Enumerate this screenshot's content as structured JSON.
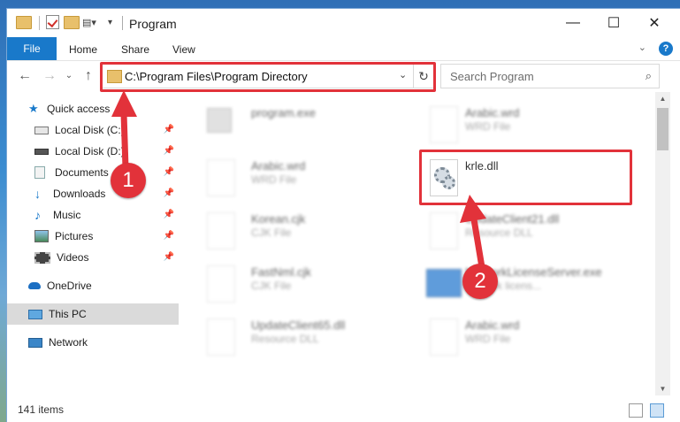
{
  "window": {
    "title": "Program",
    "minimize": "—",
    "maximize": "☐",
    "close": "✕"
  },
  "ribbon": {
    "tabs": [
      "File",
      "Home",
      "Share",
      "View"
    ],
    "help": "?",
    "collapse": "⌄"
  },
  "nav": {
    "back": "←",
    "forward": "→",
    "recent": "⌄",
    "up": "↑",
    "address": "C:\\Program Files\\Program Directory",
    "address_dropdown": "⌄",
    "refresh": "↻",
    "search_placeholder": "Search Program",
    "search_icon": "⌕"
  },
  "sidebar": {
    "items": [
      {
        "label": "Quick access",
        "icon": "star-icon",
        "pinned": false
      },
      {
        "label": "Local Disk (C:)",
        "icon": "drive-icon",
        "pinned": true
      },
      {
        "label": "Local Disk (D:)",
        "icon": "drive-icon",
        "pinned": true
      },
      {
        "label": "Documents",
        "icon": "documents-icon",
        "pinned": true
      },
      {
        "label": "Downloads",
        "icon": "download-icon",
        "pinned": true
      },
      {
        "label": "Music",
        "icon": "music-icon",
        "pinned": true
      },
      {
        "label": "Pictures",
        "icon": "pictures-icon",
        "pinned": true
      },
      {
        "label": "Videos",
        "icon": "videos-icon",
        "pinned": true
      },
      {
        "label": "OneDrive",
        "icon": "cloud-icon",
        "pinned": false
      },
      {
        "label": "This PC",
        "icon": "computer-icon",
        "pinned": false,
        "selected": true
      },
      {
        "label": "Network",
        "icon": "network-icon",
        "pinned": false
      }
    ],
    "pin_glyph": "✎"
  },
  "files": {
    "left": [
      {
        "name": "program.exe",
        "type": ""
      },
      {
        "name": "Arabic.wrd",
        "type": "WRD File"
      },
      {
        "name": "Korean.cjk",
        "type": "CJK File"
      },
      {
        "name": "FastNml.cjk",
        "type": "CJK File"
      },
      {
        "name": "UpdateClient65.dll",
        "type": "Resource DLL"
      }
    ],
    "right": [
      {
        "name": "Arabic.wrd",
        "type": "WRD File"
      },
      {
        "name": "krle.dll",
        "type": ""
      },
      {
        "name": "UpdateClient21.dll",
        "type": "Resource DLL"
      },
      {
        "name": "NetworkLicenseServer.exe",
        "type": "network licens..."
      },
      {
        "name": "Arabic.wrd",
        "type": "WRD File"
      }
    ]
  },
  "status": {
    "count": "141 items"
  },
  "steps": [
    "1",
    "2"
  ],
  "colors": {
    "accent": "#1979ca",
    "highlight": "#e2323a",
    "selection": "#dadada"
  }
}
